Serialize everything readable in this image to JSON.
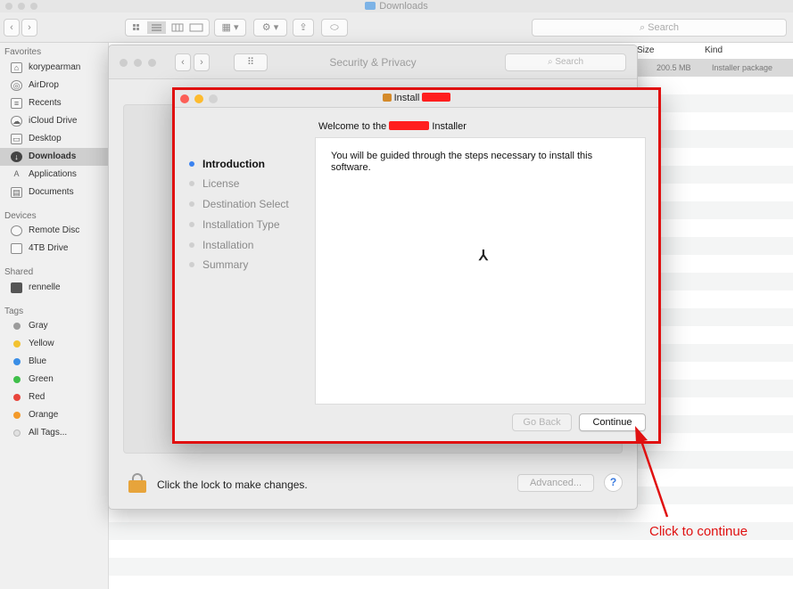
{
  "finder": {
    "title": "Downloads",
    "search_placeholder": "Search",
    "nav_back": "‹",
    "nav_forward": "›",
    "columns": {
      "size": "Size",
      "kind": "Kind"
    },
    "file": {
      "size": "200.5 MB",
      "kind": "Installer package"
    },
    "sidebar": {
      "favorites_header": "Favorites",
      "favorites": [
        {
          "label": "korypearman",
          "icon": "home-icon"
        },
        {
          "label": "AirDrop",
          "icon": "airdrop-icon"
        },
        {
          "label": "Recents",
          "icon": "recents-icon"
        },
        {
          "label": "iCloud Drive",
          "icon": "cloud-icon"
        },
        {
          "label": "Desktop",
          "icon": "desktop-icon"
        },
        {
          "label": "Downloads",
          "icon": "downloads-icon"
        },
        {
          "label": "Applications",
          "icon": "applications-icon"
        },
        {
          "label": "Documents",
          "icon": "documents-icon"
        }
      ],
      "devices_header": "Devices",
      "devices": [
        {
          "label": "Remote Disc",
          "icon": "disc-icon"
        },
        {
          "label": "4TB Drive",
          "icon": "drive-icon"
        }
      ],
      "shared_header": "Shared",
      "shared": [
        {
          "label": "rennelle",
          "icon": "computer-icon"
        }
      ],
      "tags_header": "Tags",
      "tags": [
        {
          "label": "Gray",
          "color": "#9b9b9b"
        },
        {
          "label": "Yellow",
          "color": "#f2c230"
        },
        {
          "label": "Blue",
          "color": "#3a8ee6"
        },
        {
          "label": "Green",
          "color": "#3fbf4a"
        },
        {
          "label": "Red",
          "color": "#e8453c"
        },
        {
          "label": "Orange",
          "color": "#f39a2b"
        },
        {
          "label": "All Tags...",
          "color": "#e0e0e0"
        }
      ]
    }
  },
  "security": {
    "title": "Security & Privacy",
    "search_placeholder": "Search",
    "lock_text": "Click the lock to make changes.",
    "advanced_label": "Advanced...",
    "help_label": "?"
  },
  "installer": {
    "title_prefix": "Install",
    "welcome_prefix": "Welcome to the",
    "welcome_suffix": "Installer",
    "steps": [
      "Introduction",
      "License",
      "Destination Select",
      "Installation Type",
      "Installation",
      "Summary"
    ],
    "body": "You will be guided through the steps necessary to install this software.",
    "go_back_label": "Go Back",
    "continue_label": "Continue"
  },
  "annotation": {
    "text": "Click to continue",
    "color": "#e01010"
  }
}
